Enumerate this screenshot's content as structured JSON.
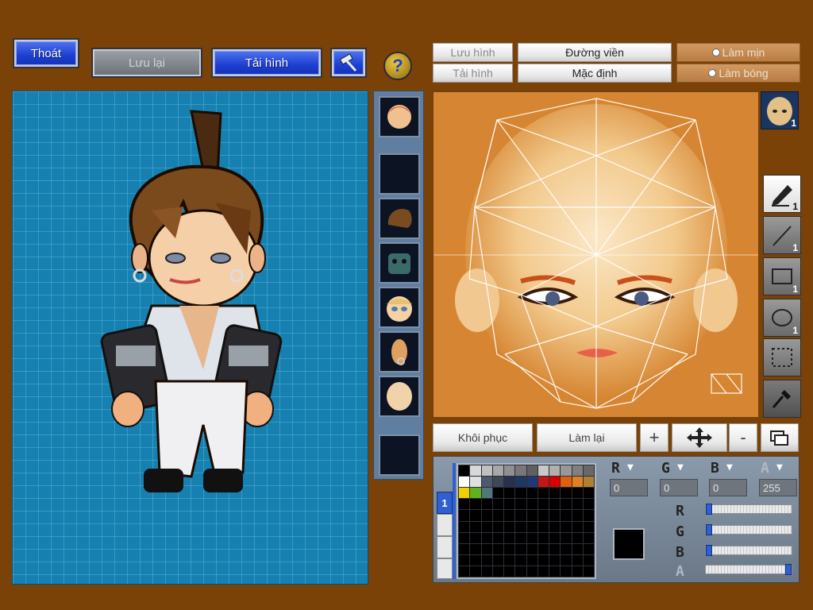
{
  "top_left": {
    "exit_label": "Thoát",
    "save_label": "Lưu lại",
    "load_label": "Tải hình"
  },
  "top_right": {
    "save_image_label": "Lưu hình",
    "load_image_label": "Tải hình",
    "outline_label": "Đường viền",
    "default_label": "Mặc định",
    "smooth_label": "Làm mịn",
    "shade_label": "Làm bóng"
  },
  "parts": [
    {
      "name": "portrait",
      "color": "#d65a2a"
    },
    {
      "name": "empty",
      "color": "#0c1424"
    },
    {
      "name": "hair",
      "color": "#7a4a20"
    },
    {
      "name": "armor",
      "color": "#3a6a6a"
    },
    {
      "name": "face",
      "color": "#e8c070"
    },
    {
      "name": "ear",
      "color": "#e0a060"
    },
    {
      "name": "body",
      "color": "#f2d2a8"
    },
    {
      "name": "empty",
      "color": "#0c1424"
    }
  ],
  "tools": {
    "pen_count": "1",
    "line_count": "1",
    "rect_count": "1",
    "ellipse_count": "1",
    "face_badge": "1"
  },
  "bottom": {
    "restore_label": "Khôi phục",
    "redo_label": "Làm lại",
    "zoom_in": "+",
    "zoom_out": "-"
  },
  "palette": {
    "swatches": [
      "#000000",
      "#d8d8d8",
      "#c0c0c0",
      "#a8a8a8",
      "#909090",
      "#787878",
      "#606060",
      "#c8c8c8",
      "#b0b0b0",
      "#989898",
      "#808080",
      "#686868",
      "#ffffff",
      "#e0e0e0",
      "#505870",
      "#404858",
      "#283050",
      "#203860",
      "#203878",
      "#c01818",
      "#d80000",
      "#e06010",
      "#e08020",
      "#b08030",
      "#f0d000",
      "#60b020",
      "#507878"
    ],
    "layer_tab": "1"
  },
  "color": {
    "r_label": "R",
    "g_label": "G",
    "b_label": "B",
    "a_label": "A",
    "r": "0",
    "g": "0",
    "b": "0",
    "a": "255",
    "current": "#000000"
  }
}
